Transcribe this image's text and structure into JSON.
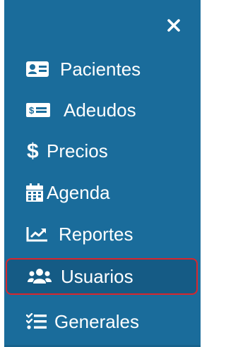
{
  "sidebar": {
    "background": "#1a6c9b",
    "accent": "#d9262c",
    "close_icon": "close-icon",
    "items": [
      {
        "label": "Pacientes",
        "icon": "id-card-icon"
      },
      {
        "label": "Adeudos",
        "icon": "money-bill-icon"
      },
      {
        "label": "Precios",
        "icon": "dollar-sign-icon"
      },
      {
        "label": "Agenda",
        "icon": "calendar-icon"
      },
      {
        "label": "Reportes",
        "icon": "chart-line-icon"
      },
      {
        "label": "Usuarios",
        "icon": "users-icon",
        "active": true
      },
      {
        "label": "Generales",
        "icon": "list-check-icon"
      }
    ]
  }
}
